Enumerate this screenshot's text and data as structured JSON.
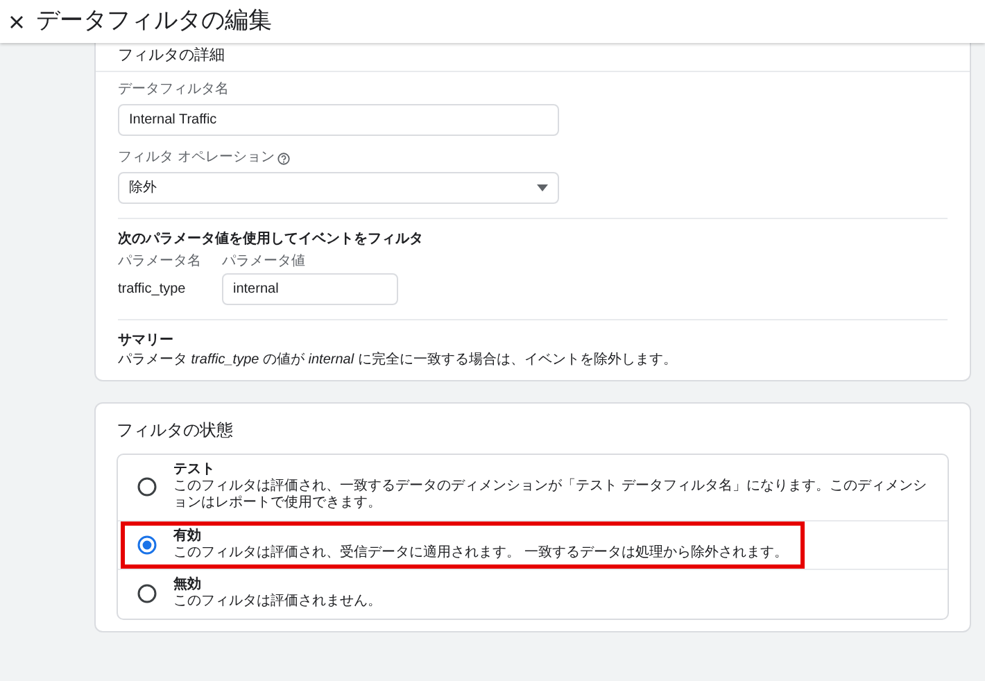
{
  "window": {
    "title": "データフィルタの編集"
  },
  "details": {
    "heading": "フィルタの詳細",
    "name_field": {
      "label": "データフィルタ名",
      "value": "Internal Traffic"
    },
    "operation_field": {
      "label": "フィルタ オペレーション",
      "value": "除外"
    },
    "params": {
      "heading": "次のパラメータ値を使用してイベントをフィルタ",
      "name_label": "パラメータ名",
      "value_label": "パラメータ値",
      "name": "traffic_type",
      "value": "internal"
    },
    "summary": {
      "heading": "サマリー",
      "text": "パラメータ *traffic_type* の値が *internal* に完全に一致する場合は、イベントを除外します。"
    }
  },
  "state": {
    "heading": "フィルタの状態",
    "options": [
      {
        "label": "テスト",
        "description": "このフィルタは評価され、一致するデータのディメンションが「テスト データフィルタ名」になります。このディメンションはレポートで使用できます。",
        "selected": false,
        "highlighted": false
      },
      {
        "label": "有効",
        "description": "このフィルタは評価され、受信データに適用されます。 一致するデータは処理から除外されます。",
        "selected": true,
        "highlighted": true
      },
      {
        "label": "無効",
        "description": "このフィルタは評価されません。",
        "selected": false,
        "highlighted": false
      }
    ]
  }
}
